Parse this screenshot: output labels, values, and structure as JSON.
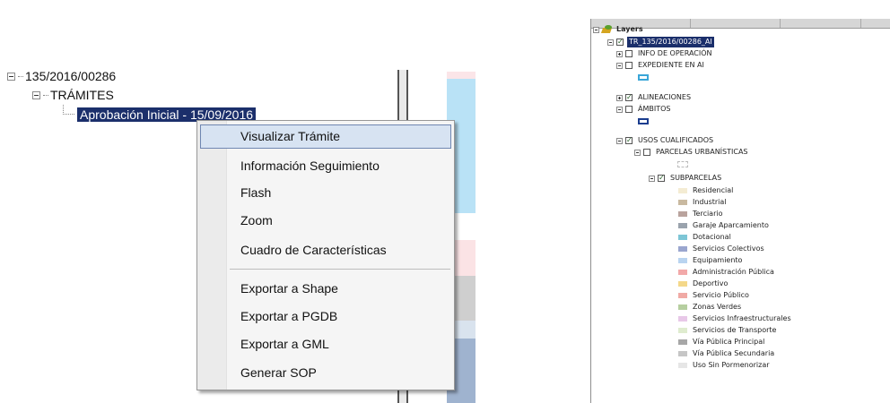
{
  "tree": {
    "root_label": "135/2016/00286",
    "tramites_label": "TRÁMITES",
    "aprobacion_label": "Aprobación Inicial - 15/09/2016"
  },
  "context_menu": {
    "items": [
      {
        "label": "Visualizar Trámite",
        "highlighted": true
      },
      {
        "label": "Información Seguimiento"
      },
      {
        "label": "Flash"
      },
      {
        "label": "Zoom"
      },
      {
        "label": "Cuadro de Características"
      },
      {
        "label": "Exportar a Shape"
      },
      {
        "label": "Exportar a PGDB"
      },
      {
        "label": "Exportar a GML"
      },
      {
        "label": "Generar SOP"
      }
    ]
  },
  "layers": {
    "title": "Layers",
    "selected_layer": "TR_135/2016/00286_AI",
    "groups": [
      {
        "label": "INFO DE OPERACIÓN",
        "checked": false
      },
      {
        "label": "EXPEDIENTE EN AI",
        "checked": false
      },
      {
        "label": "ALINEACIONES",
        "checked": true
      },
      {
        "label": "ÁMBITOS",
        "checked": false
      },
      {
        "label": "USOS CUALIFICADOS",
        "checked": true
      },
      {
        "label": "PARCELAS URBANÍSTICAS",
        "checked": false
      },
      {
        "label": "SUBPARCELAS",
        "checked": true
      }
    ],
    "legend": [
      {
        "label": "Residencial",
        "color": "#f4ecd3"
      },
      {
        "label": "Industrial",
        "color": "#c9b9a0"
      },
      {
        "label": "Terciario",
        "color": "#b9a39d"
      },
      {
        "label": "Garaje Aparcamiento",
        "color": "#9aa3ad"
      },
      {
        "label": "Dotacional",
        "color": "#7ec6d6"
      },
      {
        "label": "Servicios Colectivos",
        "color": "#9aa6cf"
      },
      {
        "label": "Equipamiento",
        "color": "#b9d4f0"
      },
      {
        "label": "Administración Pública",
        "color": "#f2a9a9"
      },
      {
        "label": "Deportivo",
        "color": "#f4d88a"
      },
      {
        "label": "Servicio Público",
        "color": "#f0aaa5"
      },
      {
        "label": "Zonas Verdes",
        "color": "#b6cfa0"
      },
      {
        "label": "Servicios Infraestructurales",
        "color": "#e8c8e8"
      },
      {
        "label": "Servicios de Transporte",
        "color": "#dfeccf"
      },
      {
        "label": "Vía Pública Principal",
        "color": "#a7a7a7"
      },
      {
        "label": "Vía Pública Secundaria",
        "color": "#c6c6c6"
      },
      {
        "label": "Uso Sin Pormenorizar",
        "color": "#e6e6e6"
      }
    ]
  }
}
